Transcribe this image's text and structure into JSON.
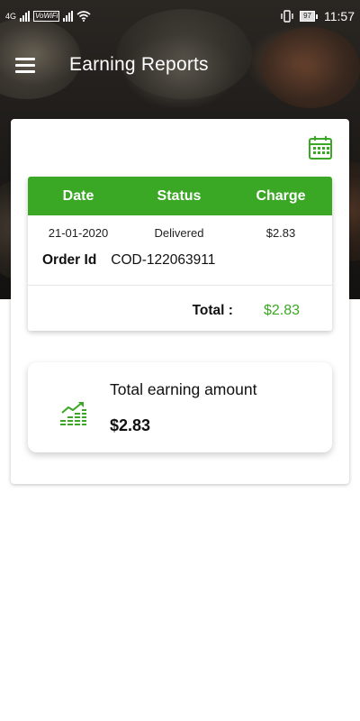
{
  "status_bar": {
    "network": "4G",
    "volte": "VoWiFi",
    "battery": "97",
    "time": "11:57"
  },
  "app_bar": {
    "menu_icon": "hamburger-menu-icon",
    "title": "Earning Reports"
  },
  "filter": {
    "calendar_icon": "calendar-icon"
  },
  "report_table": {
    "columns": [
      "Date",
      "Status",
      "Charge"
    ],
    "rows": [
      {
        "date": "21-01-2020",
        "status": "Delivered",
        "charge": "$2.83",
        "order_id_label": "Order Id",
        "order_id": "COD-122063911"
      }
    ],
    "total_label": "Total :",
    "total_value": "$2.83"
  },
  "earnings": {
    "icon": "earnings-chart-icon",
    "title": "Total earning amount",
    "amount": "$2.83"
  },
  "colors": {
    "accent_green": "#3aa824",
    "header_dark": "#1b1917"
  }
}
